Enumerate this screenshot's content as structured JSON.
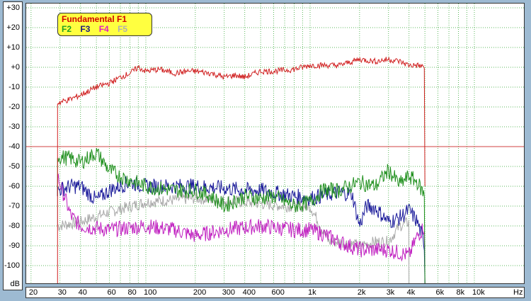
{
  "chart_data": {
    "type": "line",
    "title": "",
    "xlabel": "Hz",
    "ylabel": "dB",
    "xscale": "log",
    "xlim": [
      19,
      20200
    ],
    "ylim": [
      -109,
      32
    ],
    "yticks": [
      "+30",
      "+20",
      "+10",
      "+0",
      "-10",
      "-20",
      "-30",
      "-40",
      "-50",
      "-60",
      "-70",
      "-80",
      "-90",
      "-100"
    ],
    "ytick_values": [
      30,
      20,
      10,
      0,
      -10,
      -20,
      -30,
      -40,
      -50,
      -60,
      -70,
      -80,
      -90,
      -100
    ],
    "xticks": [
      "20",
      "30",
      "40",
      "60",
      "80",
      "100",
      "200",
      "300",
      "400",
      "600",
      "1k",
      "2k",
      "3k",
      "4k",
      "6k",
      "8k",
      "10k"
    ],
    "xtick_values": [
      20,
      30,
      40,
      60,
      80,
      100,
      200,
      300,
      400,
      600,
      1000,
      2000,
      3000,
      4000,
      6000,
      8000,
      10000
    ],
    "grid": true,
    "reference_line_db": -40,
    "legend_placement": "top-left",
    "legend": {
      "title": "Fundamental F1",
      "items": [
        "F2",
        "F3",
        "F4",
        "F5"
      ]
    },
    "series": [
      {
        "name": "Fundamental F1",
        "color": "#d02020",
        "x": [
          29,
          35,
          40,
          50,
          60,
          70,
          80,
          90,
          100,
          120,
          150,
          180,
          200,
          250,
          300,
          350,
          400,
          500,
          600,
          800,
          1000,
          1200,
          1500,
          2000,
          2500,
          3000,
          3500,
          4000,
          4500,
          5000
        ],
        "y": [
          -18,
          -16,
          -14,
          -10,
          -8,
          -5,
          -3,
          0,
          -2,
          -1,
          -3,
          -2,
          -2,
          -3,
          -5,
          -4,
          -5,
          -2,
          -2,
          -1,
          1,
          1,
          1,
          4,
          3,
          4,
          3,
          1,
          1,
          0
        ]
      },
      {
        "name": "F2",
        "color": "#20901e",
        "x": [
          29,
          35,
          40,
          50,
          60,
          70,
          80,
          100,
          120,
          150,
          200,
          250,
          300,
          400,
          500,
          600,
          800,
          1000,
          1200,
          1500,
          2000,
          2500,
          3000,
          3500,
          4000,
          4500,
          5000
        ],
        "y": [
          -45,
          -46,
          -48,
          -43,
          -52,
          -55,
          -57,
          -60,
          -61,
          -62,
          -62,
          -65,
          -70,
          -65,
          -66,
          -65,
          -70,
          -68,
          -62,
          -62,
          -58,
          -60,
          -52,
          -59,
          -55,
          -58,
          -65
        ]
      },
      {
        "name": "F3",
        "color": "#1a1a9a",
        "x": [
          29,
          35,
          40,
          50,
          60,
          80,
          100,
          150,
          200,
          300,
          400,
          500,
          800,
          1000,
          1500,
          1800,
          2000,
          2200,
          2500,
          3000,
          3500,
          4000,
          4500,
          5000
        ],
        "y": [
          -62,
          -60,
          -60,
          -67,
          -62,
          -58,
          -60,
          -60,
          -60,
          -61,
          -62,
          -62,
          -65,
          -66,
          -63,
          -64,
          -80,
          -70,
          -71,
          -78,
          -76,
          -72,
          -78,
          -90
        ]
      },
      {
        "name": "F4",
        "color": "#c020c0",
        "x": [
          29,
          35,
          40,
          60,
          100,
          150,
          200,
          300,
          500,
          800,
          1000,
          1200,
          1500,
          2000,
          3000,
          4000,
          4500,
          5000
        ],
        "y": [
          -55,
          -75,
          -80,
          -82,
          -80,
          -82,
          -85,
          -82,
          -80,
          -82,
          -82,
          -84,
          -88,
          -92,
          -92,
          -95,
          -85,
          -80
        ]
      },
      {
        "name": "F5",
        "color": "#a8a8a8",
        "x": [
          29,
          40,
          60,
          100,
          200,
          400,
          700,
          1000,
          1300,
          1500,
          2000,
          2500,
          3000,
          3500,
          4000
        ],
        "y": [
          -80,
          -78,
          -73,
          -68,
          -66,
          -68,
          -70,
          -70,
          -88,
          -88,
          -90,
          -88,
          -88,
          -80,
          -78
        ]
      }
    ]
  }
}
